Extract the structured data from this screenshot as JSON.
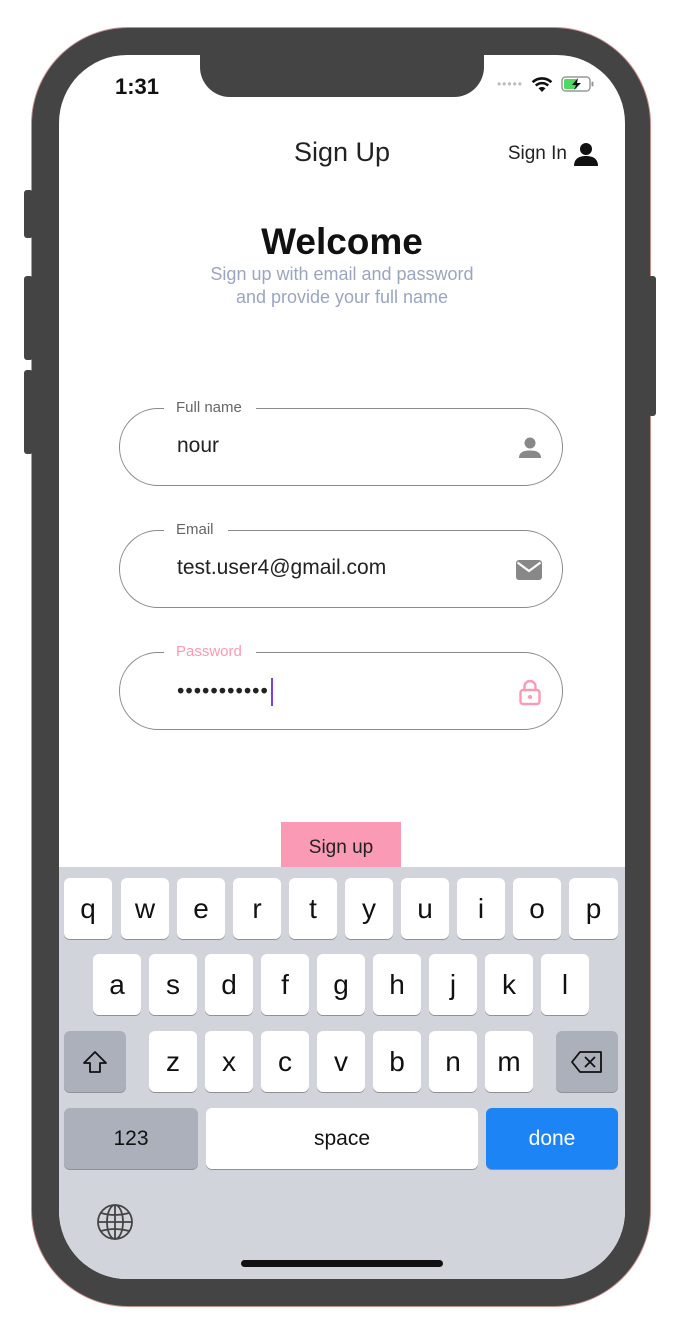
{
  "status_bar": {
    "time": "1:31"
  },
  "header": {
    "title": "Sign Up",
    "sign_in_label": "Sign In"
  },
  "welcome": {
    "title": "Welcome",
    "subtitle_line1": "Sign up with email and password",
    "subtitle_line2": "and provide your full name"
  },
  "form": {
    "full_name": {
      "label": "Full name",
      "value": "nour"
    },
    "email": {
      "label": "Email",
      "value": "test.user4@gmail.com"
    },
    "password": {
      "label": "Password",
      "value": "•••••••••••"
    },
    "submit_label": "Sign up"
  },
  "colors": {
    "accent_pink": "#fb9ab4",
    "done_blue": "#1c84f5",
    "caret_purple": "#7b3fe4",
    "subtitle_gray": "#9aa6bf"
  },
  "keyboard": {
    "row1": [
      "q",
      "w",
      "e",
      "r",
      "t",
      "y",
      "u",
      "i",
      "o",
      "p"
    ],
    "row2": [
      "a",
      "s",
      "d",
      "f",
      "g",
      "h",
      "j",
      "k",
      "l"
    ],
    "row3": [
      "z",
      "x",
      "c",
      "v",
      "b",
      "n",
      "m"
    ],
    "numbers_label": "123",
    "space_label": "space",
    "done_label": "done",
    "shift_icon": "shift-icon",
    "delete_icon": "backspace-icon",
    "globe_icon": "globe-icon"
  }
}
